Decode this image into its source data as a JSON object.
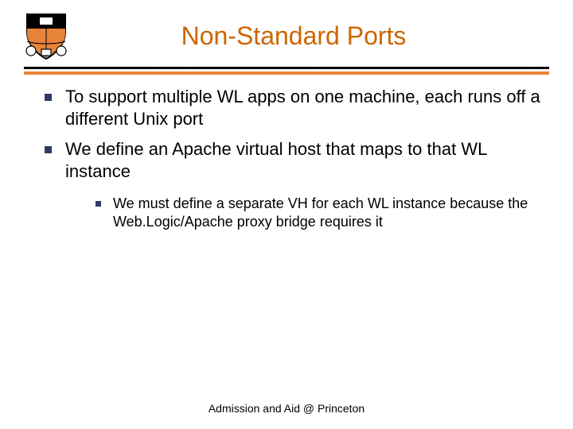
{
  "slide": {
    "title": "Non-Standard Ports",
    "bullets": [
      {
        "text": "To support multiple WL apps on one machine, each runs off a different Unix port"
      },
      {
        "text": "We define an Apache virtual host that maps to that WL instance"
      }
    ],
    "sub_bullet": "We must define a separate VH for each WL instance because the Web.Logic/Apache proxy bridge requires it",
    "footer": "Admission and Aid @ Princeton",
    "logo": {
      "name": "princeton-shield",
      "accent": "#E8833A",
      "dark": "#000000"
    }
  }
}
